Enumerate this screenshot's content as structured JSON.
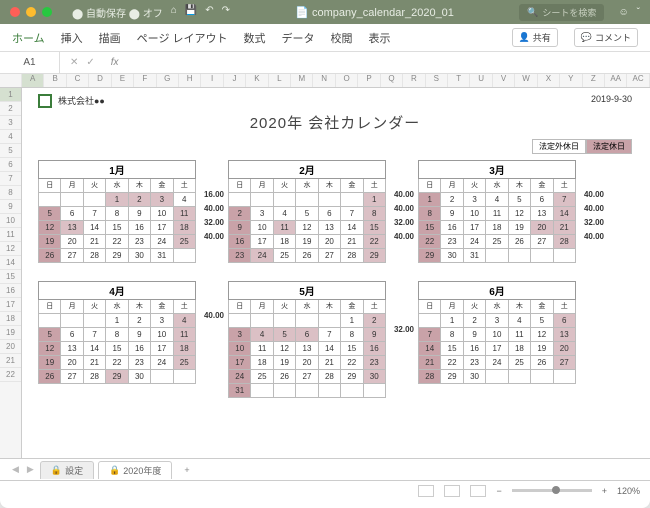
{
  "filename": "company_calendar_2020_01",
  "search_placeholder": "シートを検索",
  "ribbon": [
    "ホーム",
    "挿入",
    "描画",
    "ページ レイアウト",
    "数式",
    "データ",
    "校閲",
    "表示"
  ],
  "share": "共有",
  "comment": "コメント",
  "cellref": "A1",
  "cols": [
    "A",
    "B",
    "C",
    "D",
    "E",
    "F",
    "G",
    "H",
    "I",
    "J",
    "K",
    "L",
    "M",
    "N",
    "O",
    "P",
    "Q",
    "R",
    "S",
    "T",
    "U",
    "V",
    "W",
    "X",
    "Y",
    "Z",
    "AA",
    "AC"
  ],
  "rows": [
    "1",
    "2",
    "3",
    "4",
    "5",
    "6",
    "7",
    "8",
    "9",
    "10",
    "11",
    "12",
    "14",
    "15",
    "16",
    "17",
    "18",
    "19",
    "20",
    "21",
    "22"
  ],
  "company": "株式会社●●",
  "asof": "2019-9-30",
  "title": "2020年 会社カレンダー",
  "legend": {
    "light": "法定外休日",
    "dark": "法定休日"
  },
  "days": [
    "日",
    "月",
    "火",
    "水",
    "木",
    "金",
    "土"
  ],
  "months": [
    {
      "name": "1月",
      "side": [
        "16.00",
        "40.00",
        "32.00",
        "40.00"
      ],
      "weeks": [
        [
          "",
          "",
          "",
          {
            "d": "1",
            "h": 1
          },
          {
            "d": "2",
            "h": 1
          },
          {
            "d": "3",
            "h": 1
          },
          "4"
        ],
        [
          {
            "d": "5",
            "h": 2
          },
          "6",
          "7",
          "8",
          "9",
          "10",
          {
            "d": "11",
            "h": 1
          }
        ],
        [
          {
            "d": "12",
            "h": 2
          },
          {
            "d": "13",
            "h": 1
          },
          "14",
          "15",
          "16",
          "17",
          {
            "d": "18",
            "h": 1
          }
        ],
        [
          {
            "d": "19",
            "h": 2
          },
          "20",
          "21",
          "22",
          "23",
          "24",
          {
            "d": "25",
            "h": 1
          }
        ],
        [
          {
            "d": "26",
            "h": 2
          },
          "27",
          "28",
          "29",
          "30",
          "31",
          ""
        ]
      ]
    },
    {
      "name": "2月",
      "side": [
        "40.00",
        "40.00",
        "32.00",
        "40.00"
      ],
      "weeks": [
        [
          "",
          "",
          "",
          "",
          "",
          "",
          {
            "d": "1",
            "h": 1
          }
        ],
        [
          {
            "d": "2",
            "h": 2
          },
          "3",
          "4",
          "5",
          "6",
          "7",
          {
            "d": "8",
            "h": 1
          }
        ],
        [
          {
            "d": "9",
            "h": 2
          },
          "10",
          {
            "d": "11",
            "h": 1
          },
          "12",
          "13",
          "14",
          {
            "d": "15",
            "h": 1
          }
        ],
        [
          {
            "d": "16",
            "h": 2
          },
          "17",
          "18",
          "19",
          "20",
          "21",
          {
            "d": "22",
            "h": 1
          }
        ],
        [
          {
            "d": "23",
            "h": 2
          },
          {
            "d": "24",
            "h": 1
          },
          "25",
          "26",
          "27",
          "28",
          {
            "d": "29",
            "h": 1
          }
        ]
      ]
    },
    {
      "name": "3月",
      "side": [
        "40.00",
        "40.00",
        "32.00",
        "40.00"
      ],
      "weeks": [
        [
          {
            "d": "1",
            "h": 2
          },
          "2",
          "3",
          "4",
          "5",
          "6",
          {
            "d": "7",
            "h": 1
          }
        ],
        [
          {
            "d": "8",
            "h": 2
          },
          "9",
          "10",
          "11",
          "12",
          "13",
          {
            "d": "14",
            "h": 1
          }
        ],
        [
          {
            "d": "15",
            "h": 2
          },
          "16",
          "17",
          "18",
          "19",
          {
            "d": "20",
            "h": 1
          },
          {
            "d": "21",
            "h": 1
          }
        ],
        [
          {
            "d": "22",
            "h": 2
          },
          "23",
          "24",
          "25",
          "26",
          "27",
          {
            "d": "28",
            "h": 1
          }
        ],
        [
          {
            "d": "29",
            "h": 2
          },
          "30",
          "31",
          "",
          "",
          "",
          ""
        ]
      ]
    },
    {
      "name": "4月",
      "side": [
        "40.00",
        "",
        "",
        "",
        ""
      ],
      "weeks": [
        [
          "",
          "",
          "",
          {
            "d": "1"
          },
          "2",
          "3",
          {
            "d": "4",
            "h": 1
          }
        ],
        [
          {
            "d": "5",
            "h": 2
          },
          "6",
          "7",
          "8",
          "9",
          "10",
          {
            "d": "11",
            "h": 1
          }
        ],
        [
          {
            "d": "12",
            "h": 2
          },
          "13",
          "14",
          "15",
          "16",
          "17",
          {
            "d": "18",
            "h": 1
          }
        ],
        [
          {
            "d": "19",
            "h": 2
          },
          "20",
          "21",
          "22",
          "23",
          "24",
          {
            "d": "25",
            "h": 1
          }
        ],
        [
          {
            "d": "26",
            "h": 2
          },
          "27",
          "28",
          {
            "d": "29",
            "h": 1
          },
          "30",
          "",
          ""
        ]
      ]
    },
    {
      "name": "5月",
      "side": [
        "",
        "32.00",
        "",
        "",
        ""
      ],
      "weeks": [
        [
          "",
          "",
          "",
          "",
          "",
          {
            "d": "1"
          },
          {
            "d": "2",
            "h": 1
          }
        ],
        [
          {
            "d": "3",
            "h": 2
          },
          {
            "d": "4",
            "h": 1
          },
          {
            "d": "5",
            "h": 1
          },
          {
            "d": "6",
            "h": 1
          },
          "7",
          "8",
          {
            "d": "9",
            "h": 1
          }
        ],
        [
          {
            "d": "10",
            "h": 2
          },
          "11",
          "12",
          "13",
          "14",
          "15",
          {
            "d": "16",
            "h": 1
          }
        ],
        [
          {
            "d": "17",
            "h": 2
          },
          "18",
          "19",
          "20",
          "21",
          "22",
          {
            "d": "23",
            "h": 1
          }
        ],
        [
          {
            "d": "24",
            "h": 2
          },
          "25",
          "26",
          "27",
          "28",
          "29",
          {
            "d": "30",
            "h": 1
          }
        ],
        [
          {
            "d": "31",
            "h": 2
          },
          "",
          "",
          "",
          "",
          "",
          ""
        ]
      ]
    },
    {
      "name": "6月",
      "side": [
        "",
        "",
        "",
        "",
        ""
      ],
      "weeks": [
        [
          "",
          {
            "d": "1"
          },
          "2",
          "3",
          "4",
          "5",
          {
            "d": "6",
            "h": 1
          }
        ],
        [
          {
            "d": "7",
            "h": 2
          },
          "8",
          "9",
          "10",
          "11",
          "12",
          {
            "d": "13",
            "h": 1
          }
        ],
        [
          {
            "d": "14",
            "h": 2
          },
          "15",
          "16",
          "17",
          "18",
          "19",
          {
            "d": "20",
            "h": 1
          }
        ],
        [
          {
            "d": "21",
            "h": 2
          },
          "22",
          "23",
          "24",
          "25",
          "26",
          {
            "d": "27",
            "h": 1
          }
        ],
        [
          {
            "d": "28",
            "h": 2
          },
          "29",
          "30",
          "",
          "",
          "",
          ""
        ]
      ]
    }
  ],
  "sheets": {
    "s1": "設定",
    "s2": "2020年度"
  },
  "zoom": "120%"
}
